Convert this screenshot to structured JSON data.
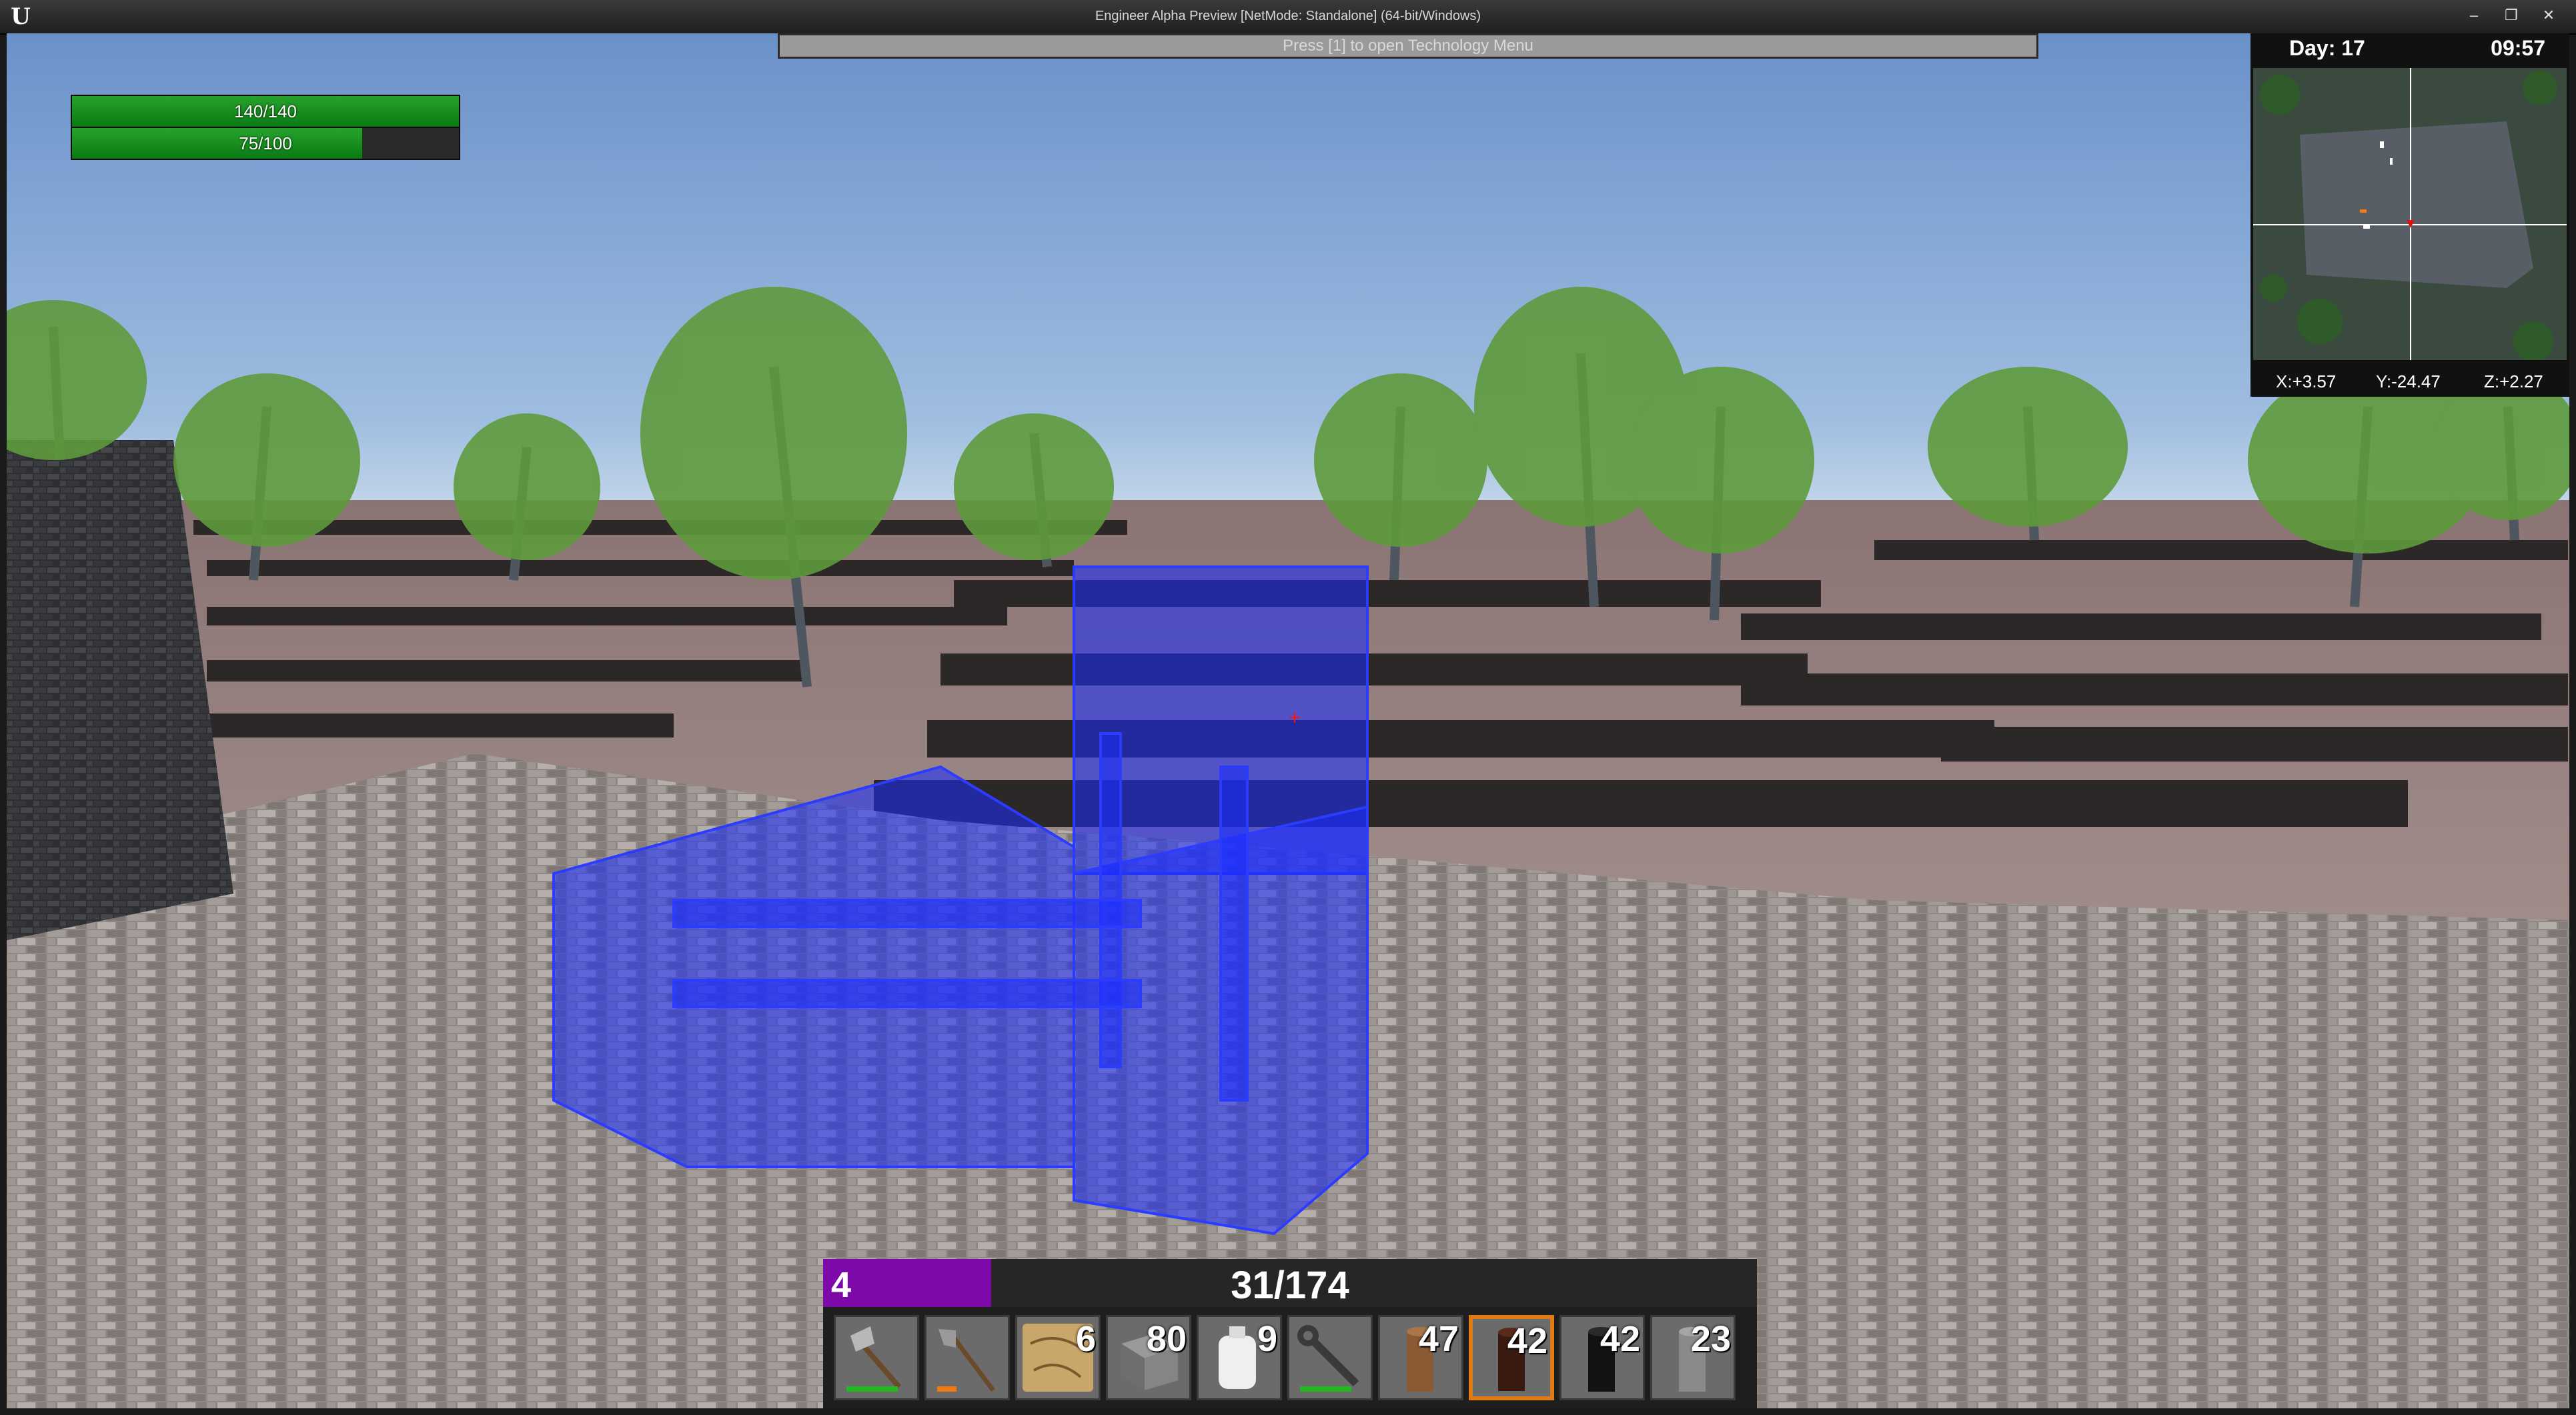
{
  "window": {
    "title": "Engineer Alpha Preview [NetMode: Standalone]  (64-bit/Windows)",
    "logo": "U",
    "controls": [
      "minimize-icon",
      "restore-icon",
      "close-icon"
    ]
  },
  "hud": {
    "health": {
      "label": "140/140",
      "fraction": 1.0,
      "color": "#1a9a22"
    },
    "stamina": {
      "label": "75/100",
      "fraction": 0.75,
      "color": "#1a9a22"
    },
    "tech_prompt": "Press [1] to open Technology Menu",
    "crosshair": "+",
    "minimap": {
      "day": "Day: 17",
      "time": "09:57",
      "coords": {
        "x": "X:+3.57",
        "y": "Y:-24.47",
        "z": "Z:+2.27"
      }
    },
    "xp": {
      "level": "4",
      "count": "31/174",
      "fraction": 0.18,
      "color": "#7d0aa8"
    },
    "hotbar": [
      {
        "icon": "axe-icon",
        "qty": "",
        "durability": 0.8,
        "durability_color": "#1fb81f"
      },
      {
        "icon": "shovel-icon",
        "qty": "",
        "durability": 0.3,
        "durability_color": "#f07a10"
      },
      {
        "icon": "blueprint-scroll-icon",
        "qty": "6"
      },
      {
        "icon": "stone-block-icon",
        "qty": "80"
      },
      {
        "icon": "cloth-bag-icon",
        "qty": "9"
      },
      {
        "icon": "wrench-icon",
        "qty": "",
        "durability": 0.8,
        "durability_color": "#1fb81f"
      },
      {
        "icon": "wooden-post-icon",
        "qty": "47"
      },
      {
        "icon": "dark-post-icon",
        "qty": "42",
        "selected": true
      },
      {
        "icon": "black-post-icon",
        "qty": "42"
      },
      {
        "icon": "stone-pillar-icon",
        "qty": "23"
      }
    ]
  }
}
